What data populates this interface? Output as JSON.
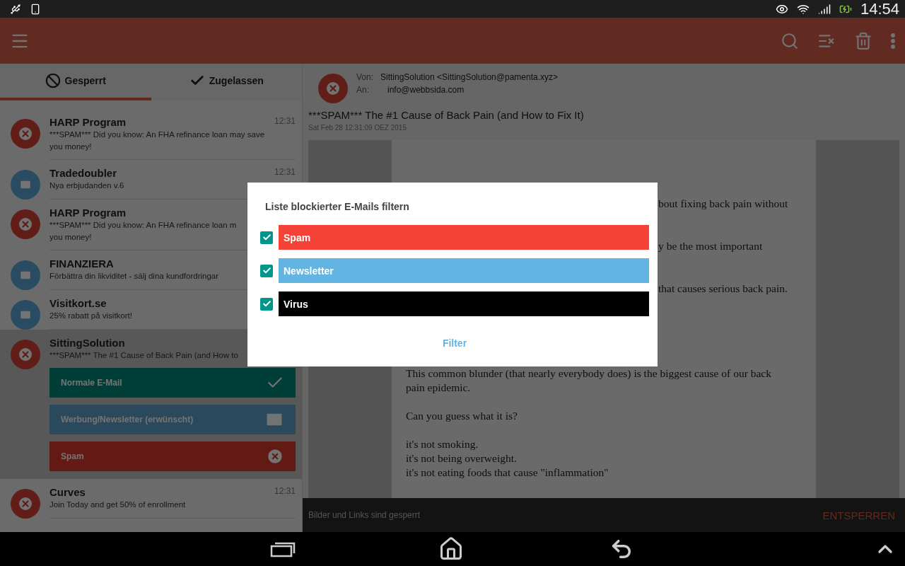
{
  "status_bar": {
    "time": "14:54"
  },
  "tabs": [
    {
      "label": "Gesperrt",
      "kind": "blocked",
      "selected": true
    },
    {
      "label": "Zugelassen",
      "kind": "allowed",
      "selected": false
    }
  ],
  "messages": [
    {
      "sender": "HARP Program",
      "time": "12:31",
      "preview": [
        "***SPAM*** Did you know: An FHA refinance loan may save",
        "you money!"
      ],
      "kind": "spam",
      "expanded": false
    },
    {
      "sender": "Tradedoubler",
      "time": "12:31",
      "preview": [
        "Nya erbjudanden v.6"
      ],
      "kind": "mail",
      "expanded": false
    },
    {
      "sender": "HARP Program",
      "preview": [
        "***SPAM*** Did you know: An FHA refinance loan m",
        "you money!"
      ],
      "kind": "spam",
      "expanded": false
    },
    {
      "sender": "FINANZIERA",
      "preview": [
        "Förbättra din likviditet - sälj dina kundfordringar"
      ],
      "kind": "mail",
      "expanded": false
    },
    {
      "sender": "Visitkort.se",
      "preview": [
        "25% rabatt på visitkort!"
      ],
      "kind": "mail",
      "expanded": false
    },
    {
      "sender": "SittingSolution",
      "preview": [
        "***SPAM*** The #1 Cause of Back Pain (and How to"
      ],
      "kind": "spam",
      "expanded": true,
      "actions": [
        {
          "label": "Normale E-Mail",
          "kind": "normal"
        },
        {
          "label": "Werbung/Newsletter (erwünscht)",
          "kind": "newsletter"
        },
        {
          "label": "Spam",
          "kind": "spam"
        }
      ]
    },
    {
      "sender": "Curves",
      "time": "12:31",
      "preview": [
        "Join Today and get 50% of enrollment"
      ],
      "kind": "spam",
      "expanded": false
    }
  ],
  "email": {
    "from_label": "Von:",
    "from": "SittingSolution <SittingSolution@pamenta.xyz>",
    "to_label": "An:",
    "to": "info@webbsida.com",
    "subject": "***SPAM*** The #1 Cause of Back Pain (and How to Fix It)",
    "date": "Sat Feb 28 12:31:09 OEZ 2015",
    "fragments": [
      "bout fixing back pain without",
      "y be the most important",
      "that causes serious back pain."
    ],
    "paragraphs": [
      [
        "This common blunder (that nearly everybody does) is the biggest cause of our back",
        "pain epidemic."
      ],
      [
        "Can you guess what it is?"
      ],
      [
        "it's not smoking.",
        "it's not being overweight.",
        "it's not eating foods that cause \"inflammation\""
      ]
    ]
  },
  "blocked_bar": {
    "text": "Bilder und Links sind gesperrt",
    "action": "ENTSPERREN"
  },
  "dialog": {
    "title": "Liste blockierter E-Mails filtern",
    "filters": [
      {
        "label": "Spam",
        "checked": true,
        "color": "#f44336"
      },
      {
        "label": "Newsletter",
        "checked": true,
        "color": "#62b4e3"
      },
      {
        "label": "Virus",
        "checked": true,
        "color": "#000000"
      }
    ],
    "button": "Filter"
  }
}
